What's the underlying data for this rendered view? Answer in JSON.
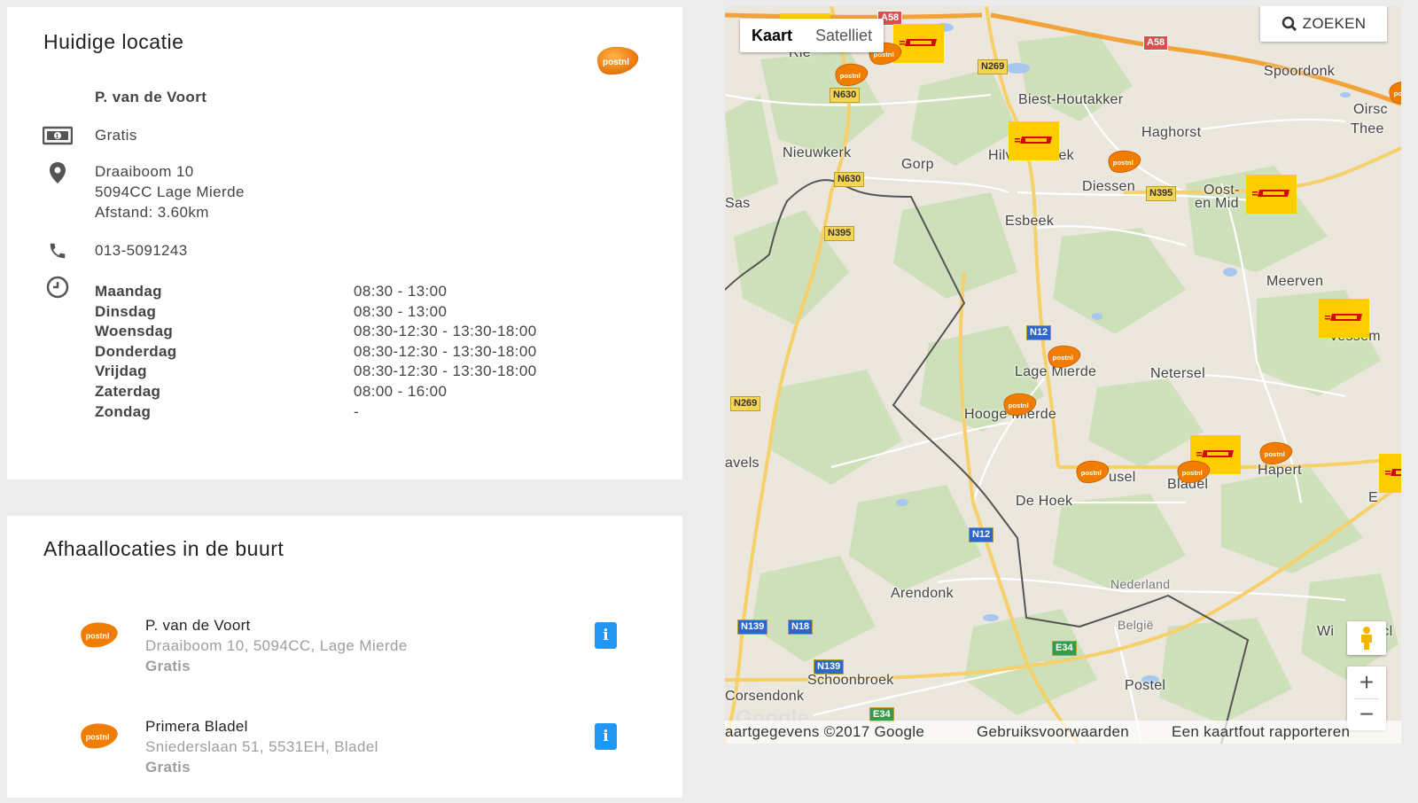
{
  "current": {
    "title": "Huidige locatie",
    "name": "P. van de Voort",
    "price": "Gratis",
    "address_line1": "Draaiboom 10",
    "address_line2": "5094CC Lage Mierde",
    "distance": "Afstand: 3.60km",
    "phone": "013-5091243",
    "hours": [
      {
        "day": "Maandag",
        "time": "08:30 - 13:00"
      },
      {
        "day": "Dinsdag",
        "time": "08:30 - 13:00"
      },
      {
        "day": "Woensdag",
        "time": "08:30-12:30 - 13:30-18:00"
      },
      {
        "day": "Donderdag",
        "time": "08:30-12:30 - 13:30-18:00"
      },
      {
        "day": "Vrijdag",
        "time": "08:30-12:30 - 13:30-18:00"
      },
      {
        "day": "Zaterdag",
        "time": "08:00 - 16:00"
      },
      {
        "day": "Zondag",
        "time": "-"
      }
    ],
    "logo_text": "postnl"
  },
  "nearby": {
    "title": "Afhaallocaties in de buurt",
    "items": [
      {
        "name": "P. van de Voort",
        "address": "Draaiboom 10, 5094CC, Lage Mierde",
        "price": "Gratis",
        "info": "i"
      },
      {
        "name": "Primera Bladel",
        "address": "Sniederslaan 51, 5531EH, Bladel",
        "price": "Gratis",
        "info": "i"
      }
    ]
  },
  "map": {
    "type_map": "Kaart",
    "type_satellite": "Satelliet",
    "search": "ZOEKEN",
    "zoom_in": "+",
    "zoom_out": "−",
    "google": "Google",
    "attribution": {
      "data": "aartgegevens ©2017 Google",
      "terms": "Gebruiksvoorwaarden",
      "report": "Een kaartfout rapporteren"
    },
    "places": [
      "Spoordonk",
      "Biest-Houtakker",
      "Haghorst",
      "Oirsc",
      "Thee",
      "Nieuwkerk",
      "Gorp",
      "Hilvarenbeek",
      "Diessen",
      "Oost-",
      "en Mid",
      "rs",
      "Esbeek",
      "Sas",
      "Meerven",
      "Lage Mierde",
      "Netersel",
      "Hooge Mierde",
      "usel",
      "Bladel",
      "Hapert",
      "avels",
      "De Hoek",
      "Arendonk",
      "Nederland",
      "België",
      "Nederland",
      "België",
      "Schoonbroek",
      "Corsendonk",
      "Postel",
      "Wi",
      "L",
      "E",
      "Rie",
      "scl",
      "vessem"
    ],
    "roads": [
      "A58",
      "A58",
      "N269",
      "N630",
      "N630",
      "N395",
      "N395",
      "N12",
      "N269",
      "N12",
      "N139",
      "N18",
      "N139",
      "E34",
      "E34",
      "N18"
    ],
    "colors": {
      "postnl": "#f07d00",
      "dhl": "#ffcc00",
      "dhl_text": "#d40511",
      "road_label": "#f5d451",
      "highway_label": "#d94e4e"
    }
  }
}
